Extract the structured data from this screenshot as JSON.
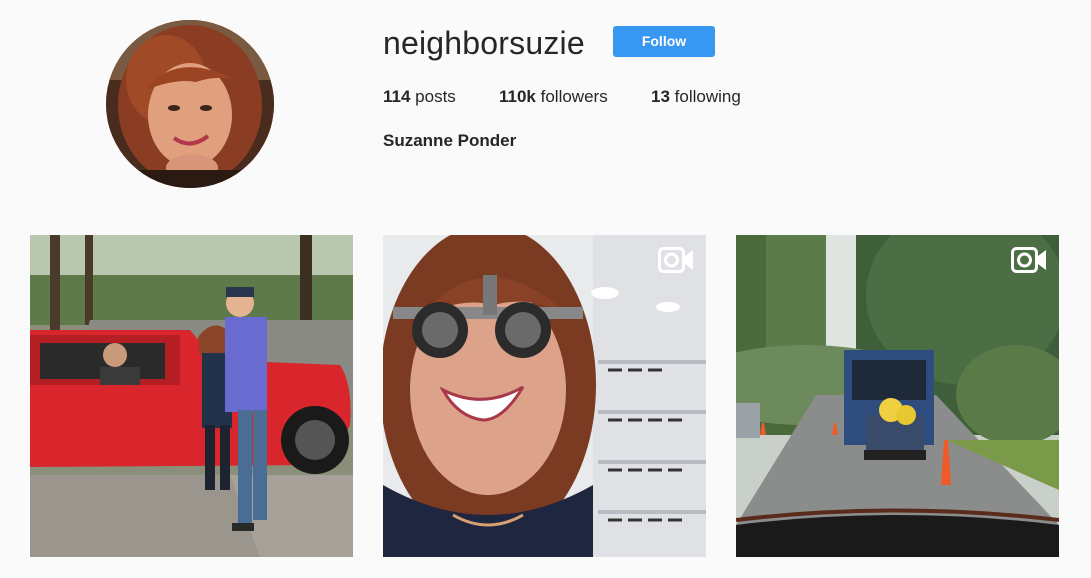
{
  "profile": {
    "username": "neighborsuzie",
    "follow_label": "Follow",
    "full_name": "Suzanne Ponder",
    "avatar_icon": "profile-photo"
  },
  "stats": {
    "posts_count": "114",
    "posts_label": "posts",
    "followers_count": "110k",
    "followers_label": "followers",
    "following_count": "13",
    "following_label": "following"
  },
  "posts": [
    {
      "type": "photo"
    },
    {
      "type": "video",
      "icon": "video-camera-icon"
    },
    {
      "type": "video",
      "icon": "video-camera-icon"
    }
  ],
  "colors": {
    "accent": "#3897f0",
    "text": "#262626",
    "background": "#fafafa"
  }
}
